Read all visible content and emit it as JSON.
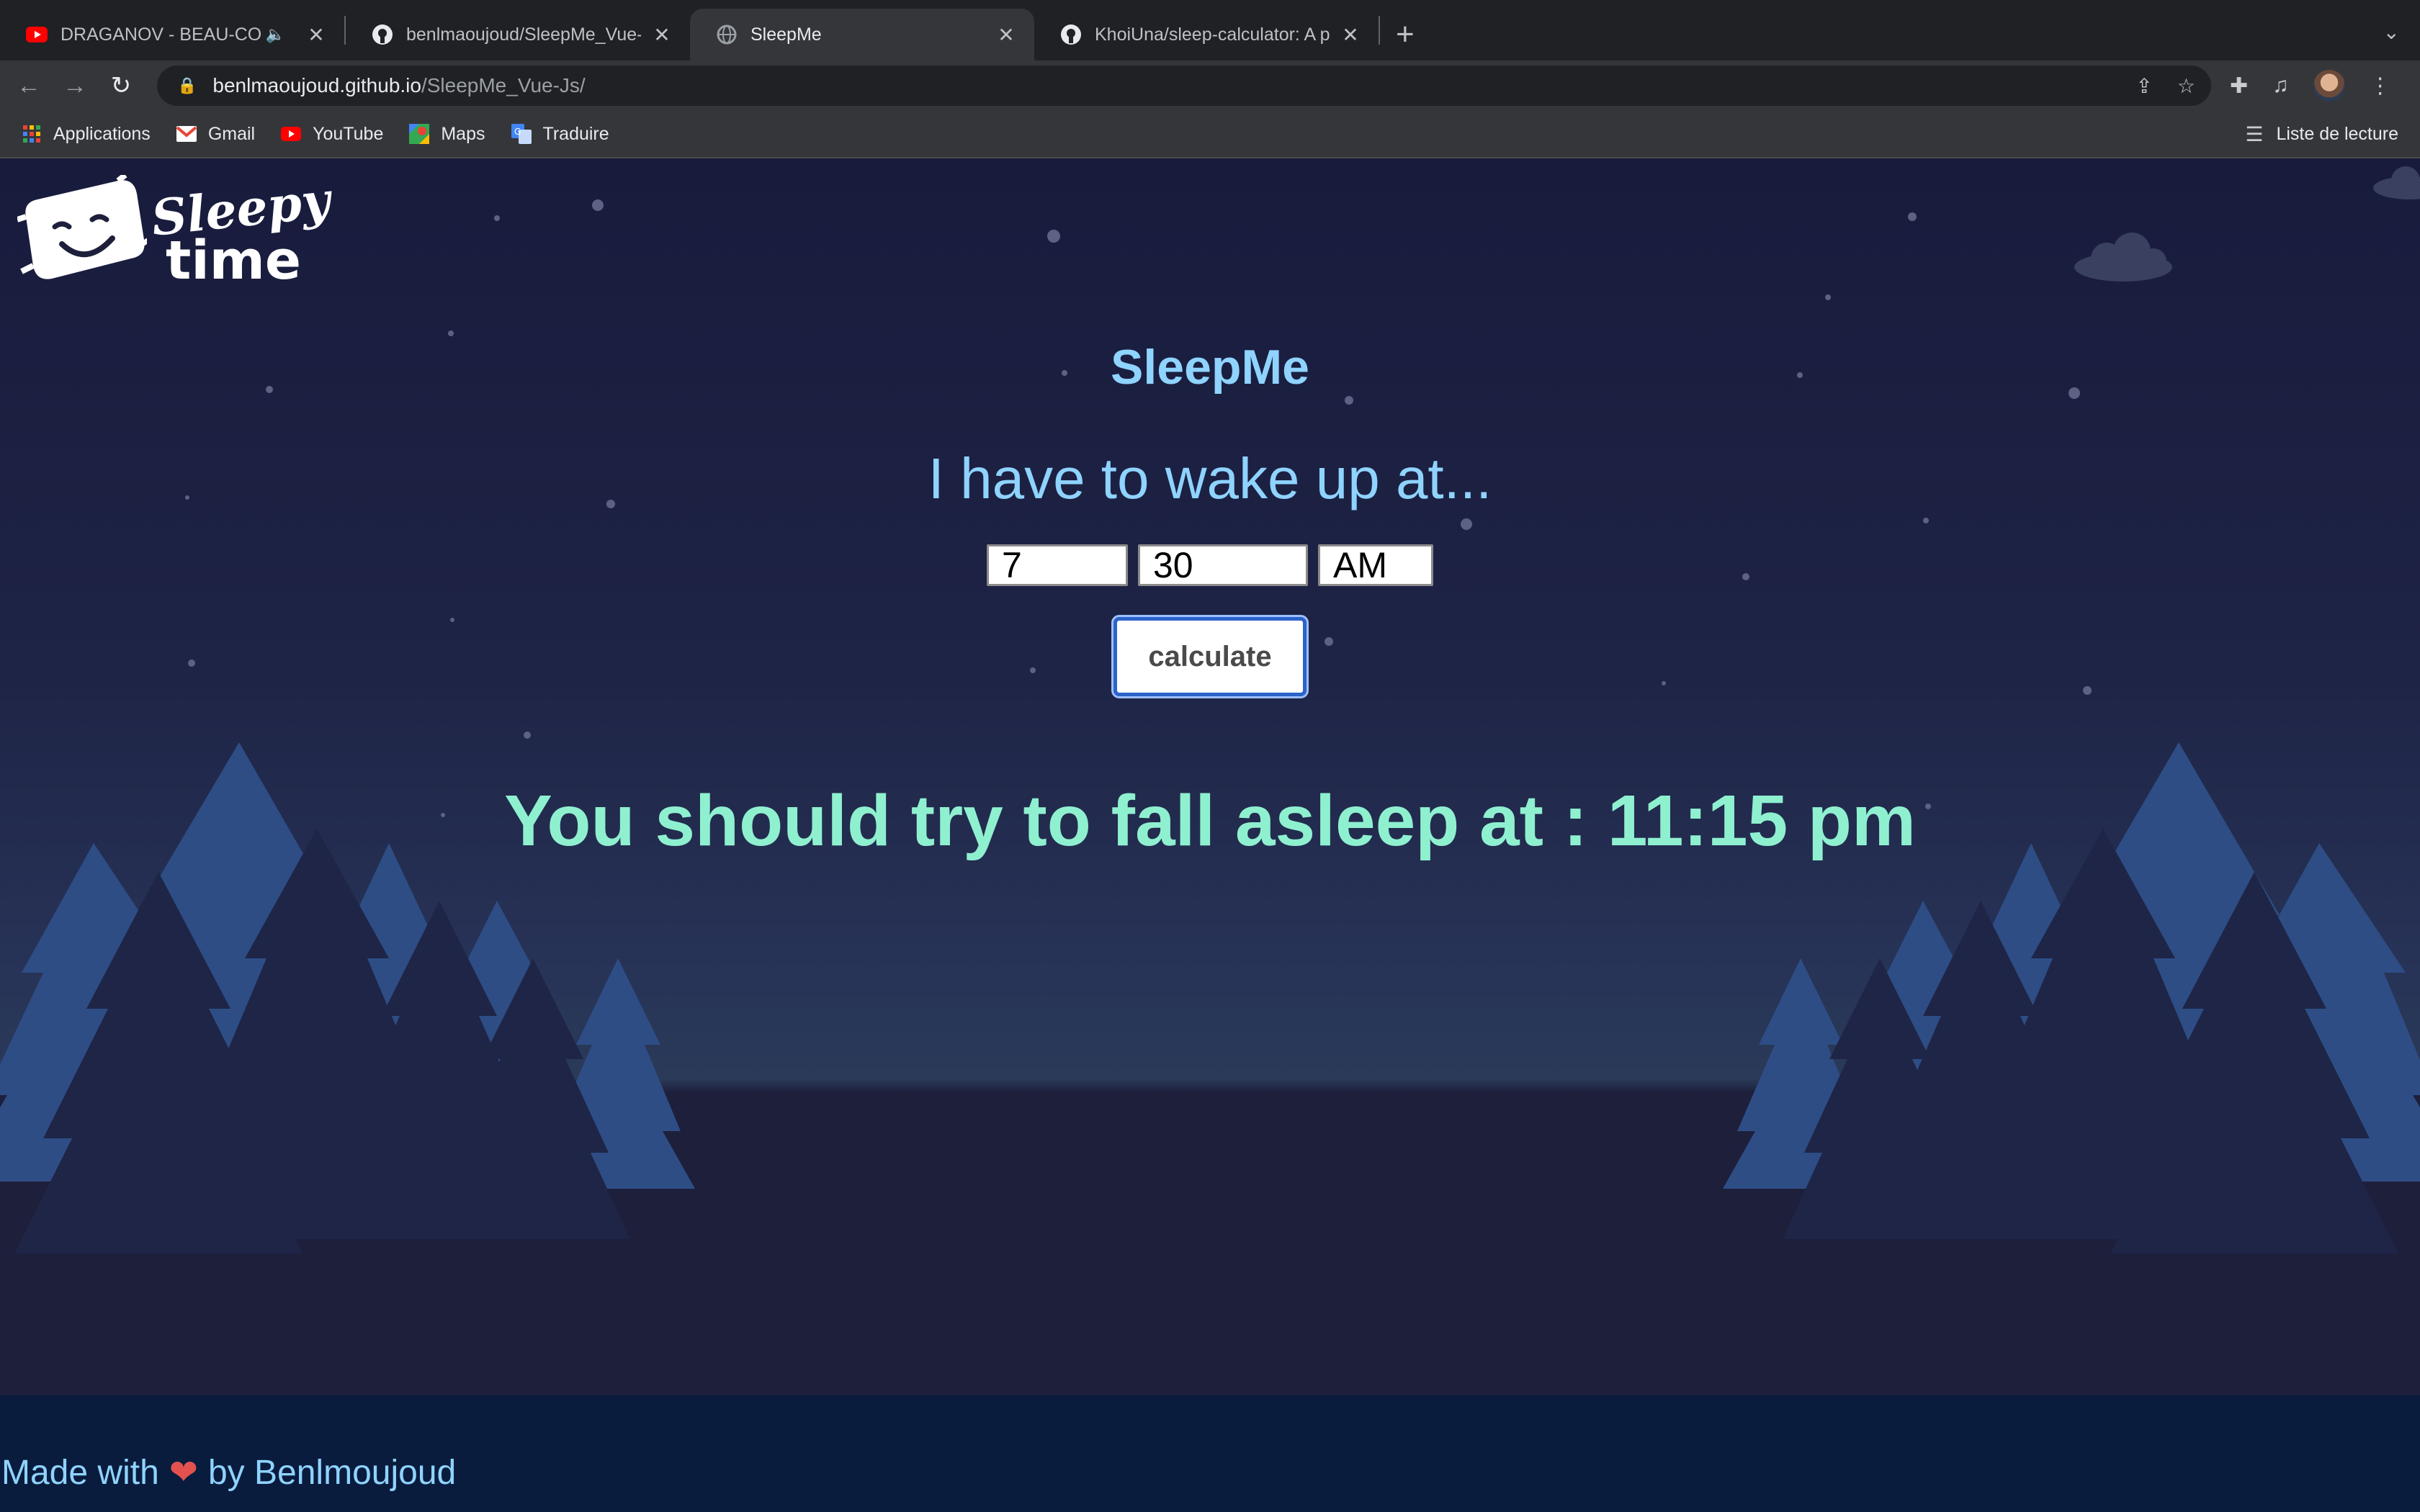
{
  "browser": {
    "tabs": [
      {
        "title": "DRAGANOV - BEAU-COUP",
        "favicon": "youtube-icon",
        "muted_icon": "speaker-icon",
        "active": false
      },
      {
        "title": "benlmaoujoud/SleepMe_Vue-J",
        "favicon": "github-icon",
        "active": false
      },
      {
        "title": "SleepMe",
        "favicon": "globe-icon",
        "active": true
      },
      {
        "title": "KhoiUna/sleep-calculator: A pr",
        "favicon": "github-icon",
        "active": false
      }
    ],
    "url_host": "benlmaoujoud.github.io",
    "url_path": "/SleepMe_Vue-Js/",
    "bookmarks": [
      {
        "label": "Applications",
        "icon": "apps-grid-icon"
      },
      {
        "label": "Gmail",
        "icon": "gmail-icon"
      },
      {
        "label": "YouTube",
        "icon": "youtube-icon"
      },
      {
        "label": "Maps",
        "icon": "maps-icon"
      },
      {
        "label": "Traduire",
        "icon": "translate-icon"
      }
    ],
    "reading_list": "Liste de lecture"
  },
  "page": {
    "logo_line1": "Sleepy",
    "logo_line2": "time",
    "title": "SleepMe",
    "subtitle": "I have to wake up at...",
    "hour": "7",
    "minute": "30",
    "period": "AM",
    "button_label": "calculate",
    "result": "You should try to fall asleep at : 11:15 pm",
    "footer_pre": "Made with",
    "footer_heart": "❤",
    "footer_post": "by Benlmoujoud"
  },
  "colors": {
    "accent_blue": "#8fd3ff",
    "result_green": "#8ff0d0",
    "footer_bg": "#0a1c3e",
    "tree": "#2e4d85"
  }
}
